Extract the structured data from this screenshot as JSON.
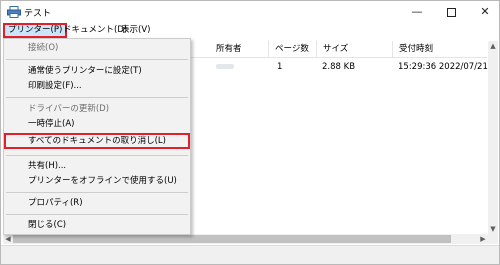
{
  "window": {
    "title": "テスト",
    "minimize_glyph": "—",
    "close_glyph": "✕"
  },
  "menubar": {
    "printer": "プリンター(P)",
    "document": "ドキュメント(D)",
    "view": "表示(V)"
  },
  "columns": {
    "owner": "所有者",
    "pages": "ページ数",
    "size": "サイズ",
    "submitted": "受付時刻"
  },
  "job": {
    "pages": "1",
    "size": "2.88 KB",
    "submitted": "15:29:36  2022/07/21"
  },
  "dropdown": {
    "connect": "接続(O)",
    "set_default": "通常使うプリンターに設定(T)",
    "print_settings": "印刷設定(F)...",
    "update_driver": "ドライバーの更新(D)",
    "pause": "一時停止(A)",
    "cancel_all": "すべてのドキュメントの取り消し(L)",
    "share": "共有(H)...",
    "use_offline": "プリンターをオフラインで使用する(U)",
    "properties": "プロパティ(R)",
    "close": "閉じる(C)"
  },
  "scrollbar": {
    "up_glyph": "▲",
    "down_glyph": "▼",
    "left_glyph": "◀",
    "right_glyph": "▶"
  },
  "icons": {
    "app": "printer-icon"
  },
  "colors": {
    "highlight": "#e0202a",
    "menu_selected": "#cce4f7",
    "menu_background": "#f2f2f2"
  }
}
